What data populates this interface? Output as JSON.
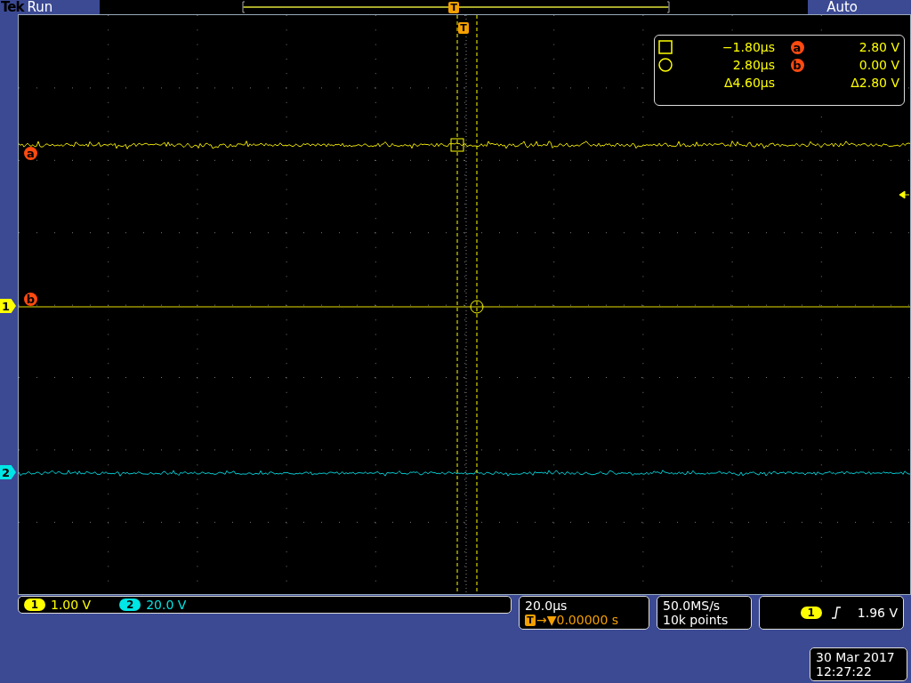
{
  "header": {
    "brand": "Tek",
    "state": "Run",
    "trigger_mode": "Auto",
    "trigger_marker": "T"
  },
  "plot": {
    "trigger_marker": "T",
    "cursor_markers": [
      "a",
      "b"
    ],
    "channel_markers": [
      {
        "label": "1",
        "color": "#ffff00"
      },
      {
        "label": "2",
        "color": "#00e5e5"
      }
    ]
  },
  "cursor_readout": [
    {
      "kind": "square",
      "time": "−1.80µs",
      "marker": "a",
      "value": "2.80 V"
    },
    {
      "kind": "circle",
      "time": "2.80µs",
      "marker": "b",
      "value": "0.00 V"
    },
    {
      "kind": "delta",
      "time": "Δ4.60µs",
      "value": "Δ2.80 V"
    }
  ],
  "channels": [
    {
      "number": "1",
      "scale": "1.00 V",
      "color": "#ffff00"
    },
    {
      "number": "2",
      "scale": "20.0 V",
      "color": "#00e5e5"
    }
  ],
  "timebase": {
    "scale": "20.0µs",
    "trigger_badge": "T",
    "position": "→▼0.00000 s"
  },
  "acquisition": {
    "rate": "50.0MS/s",
    "record": "10k points"
  },
  "trigger": {
    "channel": "1",
    "level": "1.96 V"
  },
  "datetime": {
    "date": "30 Mar 2017",
    "time": "12:27:22"
  }
}
